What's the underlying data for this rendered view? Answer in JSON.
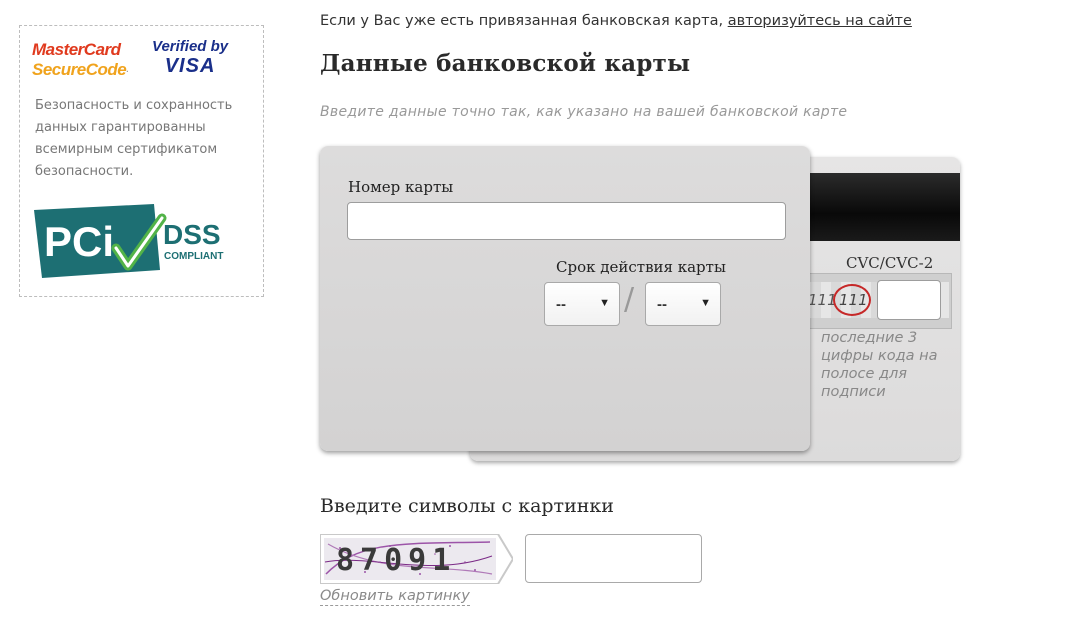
{
  "security": {
    "mastercard_line1": "MasterCard",
    "mastercard_line2": "SecureCode",
    "mastercard_tm": ".",
    "visa_line1": "Verified by",
    "visa_line2": "VISA",
    "text": "Безопасность и сохранность данных гарантированны всемирным сертификатом безопасности.",
    "pci_text": "PCi",
    "pci_dss": "DSS",
    "pci_compliant": "COMPLIANT"
  },
  "header": {
    "login_prefix": "Если у Вас уже есть привязанная банковская карта, ",
    "login_link": "авторизуйтесь на сайте",
    "title": "Данные банковской карты",
    "subtitle": "Введите данные точно так, как указано на вашей банковской карте"
  },
  "card_front": {
    "number_label": "Номер карты",
    "expiry_label": "Срок действия карты",
    "month_value": "--",
    "year_value": "--",
    "separator": "/",
    "arrow": "▼"
  },
  "card_back": {
    "cvc_label": "CVC/CVC-2",
    "digits_sample1": "111",
    "digits_sample2": "111",
    "hint": "последние 3 цифры кода на полосе для подписи"
  },
  "captcha": {
    "title": "Введите символы с картинки",
    "code": "87091",
    "refresh": "Обновить картинку"
  },
  "colors": {
    "mastercard_red": "#e03a1e",
    "mastercard_orange": "#f0a31d",
    "visa_blue": "#1a2f8a",
    "pci_teal": "#1d6f73",
    "pci_check": "#52b348",
    "cvc_circle": "#c62828",
    "captcha_purple": "#7b2a86"
  }
}
